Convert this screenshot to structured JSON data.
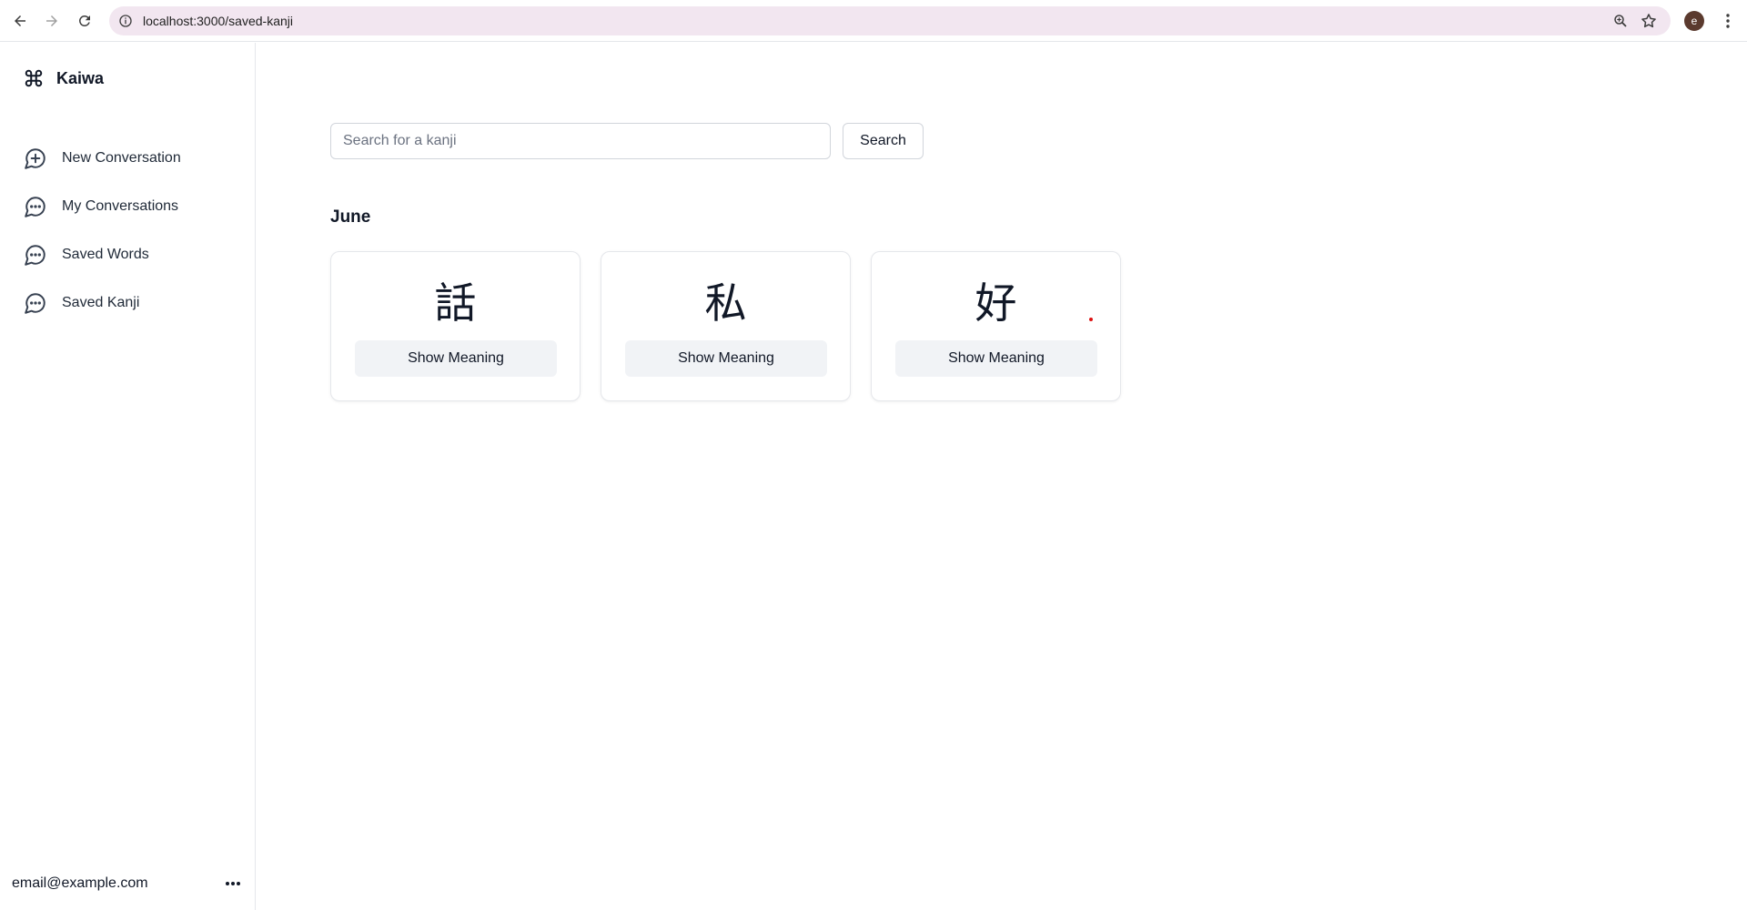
{
  "browser": {
    "url": "localhost:3000/saved-kanji",
    "profile_initial": "e"
  },
  "sidebar": {
    "brand": "Kaiwa",
    "items": [
      {
        "label": "New Conversation",
        "icon": "plus-circle-icon"
      },
      {
        "label": "My Conversations",
        "icon": "chat-bubble-icon"
      },
      {
        "label": "Saved Words",
        "icon": "chat-bubble-icon"
      },
      {
        "label": "Saved Kanji",
        "icon": "chat-bubble-icon"
      }
    ],
    "user_email": "email@example.com"
  },
  "main": {
    "search": {
      "placeholder": "Search for a kanji",
      "value": "",
      "button_label": "Search"
    },
    "month": "June",
    "cards": [
      {
        "kanji": "話",
        "button_label": "Show Meaning"
      },
      {
        "kanji": "私",
        "button_label": "Show Meaning"
      },
      {
        "kanji": "好",
        "button_label": "Show Meaning"
      }
    ]
  },
  "colors": {
    "omnibox_bg": "#f2e6f0",
    "meaning_button_bg": "#f1f3f6",
    "border": "#e5e7eb"
  }
}
